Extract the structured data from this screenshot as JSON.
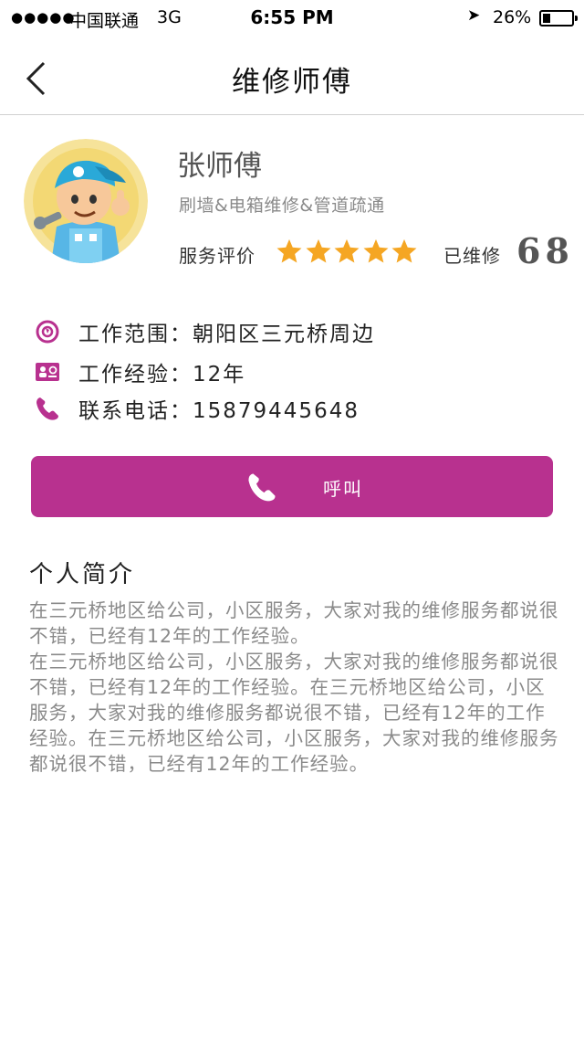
{
  "status_bar": {
    "signal": "●●●●●",
    "carrier": "中国联通",
    "network": "3G",
    "time": "6:55 PM",
    "battery_pct": "26%",
    "battery_level": 0.26
  },
  "nav": {
    "title": "维修师傅",
    "back_icon": "chevron-left-icon"
  },
  "profile": {
    "name": "张师傅",
    "skills": "刷墙&电箱维修&管道疏通",
    "rating_label": "服务评价",
    "rating_stars": 5,
    "repaired_label": "已维修",
    "repaired_count": "68"
  },
  "info": {
    "range": "工作范围：朝阳区三元桥周边",
    "experience": "工作经验：12年",
    "phone": "联系电话：15879445648"
  },
  "call_button": {
    "label": "呼叫"
  },
  "intro": {
    "title": "个人简介",
    "para1": "在三元桥地区给公司，小区服务，大家对我的维修服务都说很不错，已经有12年的工作经验。",
    "para2": "在三元桥地区给公司，小区服务，大家对我的维修服务都说很不错，已经有12年的工作经验。在三元桥地区给公司，小区服务，大家对我的维修服务都说很不错，已经有12年的工作经验。在三元桥地区给公司，小区服务，大家对我的维修服务都说很不错，已经有12年的工作经验。"
  },
  "colors": {
    "accent": "#b8318f",
    "star": "#f5a623",
    "icon": "#b8318f"
  }
}
